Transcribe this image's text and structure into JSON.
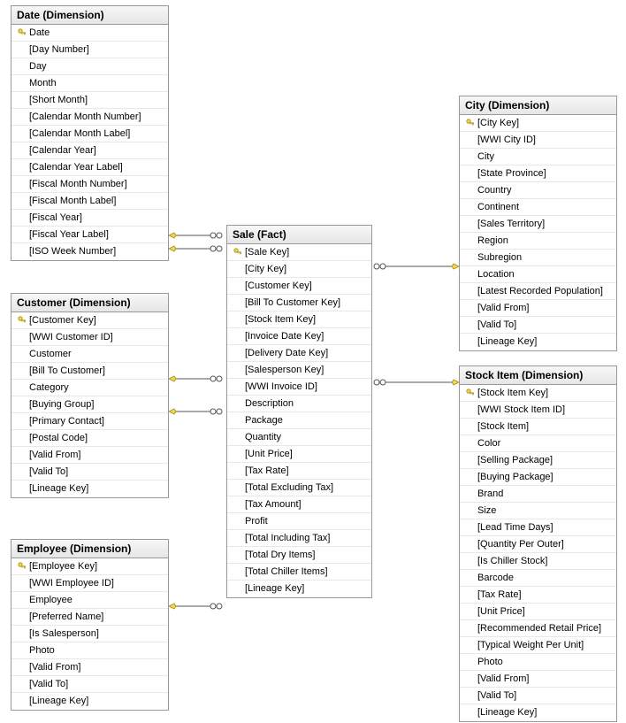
{
  "tables": {
    "date": {
      "title": "Date (Dimension)",
      "columns": [
        {
          "name": "Date",
          "pk": true
        },
        {
          "name": "[Day Number]",
          "pk": false
        },
        {
          "name": "Day",
          "pk": false
        },
        {
          "name": "Month",
          "pk": false
        },
        {
          "name": "[Short Month]",
          "pk": false
        },
        {
          "name": "[Calendar Month Number]",
          "pk": false
        },
        {
          "name": "[Calendar Month Label]",
          "pk": false
        },
        {
          "name": "[Calendar Year]",
          "pk": false
        },
        {
          "name": "[Calendar Year Label]",
          "pk": false
        },
        {
          "name": "[Fiscal Month Number]",
          "pk": false
        },
        {
          "name": "[Fiscal Month Label]",
          "pk": false
        },
        {
          "name": "[Fiscal Year]",
          "pk": false
        },
        {
          "name": "[Fiscal Year Label]",
          "pk": false
        },
        {
          "name": "[ISO Week Number]",
          "pk": false
        }
      ]
    },
    "customer": {
      "title": "Customer (Dimension)",
      "columns": [
        {
          "name": "[Customer Key]",
          "pk": true
        },
        {
          "name": "[WWI Customer ID]",
          "pk": false
        },
        {
          "name": "Customer",
          "pk": false
        },
        {
          "name": "[Bill To Customer]",
          "pk": false
        },
        {
          "name": "Category",
          "pk": false
        },
        {
          "name": "[Buying Group]",
          "pk": false
        },
        {
          "name": "[Primary Contact]",
          "pk": false
        },
        {
          "name": "[Postal Code]",
          "pk": false
        },
        {
          "name": "[Valid From]",
          "pk": false
        },
        {
          "name": "[Valid To]",
          "pk": false
        },
        {
          "name": "[Lineage Key]",
          "pk": false
        }
      ]
    },
    "employee": {
      "title": "Employee (Dimension)",
      "columns": [
        {
          "name": "[Employee Key]",
          "pk": true
        },
        {
          "name": "[WWI Employee ID]",
          "pk": false
        },
        {
          "name": "Employee",
          "pk": false
        },
        {
          "name": "[Preferred Name]",
          "pk": false
        },
        {
          "name": "[Is Salesperson]",
          "pk": false
        },
        {
          "name": "Photo",
          "pk": false
        },
        {
          "name": "[Valid From]",
          "pk": false
        },
        {
          "name": "[Valid To]",
          "pk": false
        },
        {
          "name": "[Lineage Key]",
          "pk": false
        }
      ]
    },
    "sale": {
      "title": "Sale (Fact)",
      "columns": [
        {
          "name": "[Sale Key]",
          "pk": true
        },
        {
          "name": "[City Key]",
          "pk": false
        },
        {
          "name": "[Customer Key]",
          "pk": false
        },
        {
          "name": "[Bill To Customer Key]",
          "pk": false
        },
        {
          "name": "[Stock Item Key]",
          "pk": false
        },
        {
          "name": "[Invoice Date Key]",
          "pk": false
        },
        {
          "name": "[Delivery Date Key]",
          "pk": false
        },
        {
          "name": "[Salesperson Key]",
          "pk": false
        },
        {
          "name": "[WWI Invoice ID]",
          "pk": false
        },
        {
          "name": "Description",
          "pk": false
        },
        {
          "name": "Package",
          "pk": false
        },
        {
          "name": "Quantity",
          "pk": false
        },
        {
          "name": "[Unit Price]",
          "pk": false
        },
        {
          "name": "[Tax Rate]",
          "pk": false
        },
        {
          "name": "[Total Excluding Tax]",
          "pk": false
        },
        {
          "name": "[Tax Amount]",
          "pk": false
        },
        {
          "name": "Profit",
          "pk": false
        },
        {
          "name": "[Total Including Tax]",
          "pk": false
        },
        {
          "name": "[Total Dry Items]",
          "pk": false
        },
        {
          "name": "[Total Chiller Items]",
          "pk": false
        },
        {
          "name": "[Lineage Key]",
          "pk": false
        }
      ]
    },
    "city": {
      "title": "City (Dimension)",
      "columns": [
        {
          "name": "[City Key]",
          "pk": true
        },
        {
          "name": "[WWI City ID]",
          "pk": false
        },
        {
          "name": "City",
          "pk": false
        },
        {
          "name": "[State Province]",
          "pk": false
        },
        {
          "name": "Country",
          "pk": false
        },
        {
          "name": "Continent",
          "pk": false
        },
        {
          "name": "[Sales Territory]",
          "pk": false
        },
        {
          "name": "Region",
          "pk": false
        },
        {
          "name": "Subregion",
          "pk": false
        },
        {
          "name": "Location",
          "pk": false
        },
        {
          "name": "[Latest Recorded Population]",
          "pk": false
        },
        {
          "name": "[Valid From]",
          "pk": false
        },
        {
          "name": "[Valid To]",
          "pk": false
        },
        {
          "name": "[Lineage Key]",
          "pk": false
        }
      ]
    },
    "stockitem": {
      "title": "Stock Item (Dimension)",
      "columns": [
        {
          "name": "[Stock Item Key]",
          "pk": true
        },
        {
          "name": "[WWI Stock Item ID]",
          "pk": false
        },
        {
          "name": "[Stock Item]",
          "pk": false
        },
        {
          "name": "Color",
          "pk": false
        },
        {
          "name": "[Selling Package]",
          "pk": false
        },
        {
          "name": "[Buying Package]",
          "pk": false
        },
        {
          "name": "Brand",
          "pk": false
        },
        {
          "name": "Size",
          "pk": false
        },
        {
          "name": "[Lead Time Days]",
          "pk": false
        },
        {
          "name": "[Quantity Per Outer]",
          "pk": false
        },
        {
          "name": "[Is Chiller Stock]",
          "pk": false
        },
        {
          "name": "Barcode",
          "pk": false
        },
        {
          "name": "[Tax Rate]",
          "pk": false
        },
        {
          "name": "[Unit Price]",
          "pk": false
        },
        {
          "name": "[Recommended Retail Price]",
          "pk": false
        },
        {
          "name": "[Typical Weight Per Unit]",
          "pk": false
        },
        {
          "name": "Photo",
          "pk": false
        },
        {
          "name": "[Valid From]",
          "pk": false
        },
        {
          "name": "[Valid To]",
          "pk": false
        },
        {
          "name": "[Lineage Key]",
          "pk": false
        }
      ]
    }
  }
}
